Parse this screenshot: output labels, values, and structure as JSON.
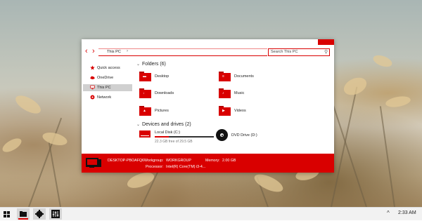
{
  "explorer": {
    "address": "This PC",
    "search_placeholder": "Search This PC",
    "sidebar": [
      {
        "label": "Quick access",
        "icon": "star-icon"
      },
      {
        "label": "OneDrive",
        "icon": "cloud-icon"
      },
      {
        "label": "This PC",
        "icon": "computer-icon",
        "selected": true
      },
      {
        "label": "Network",
        "icon": "network-icon"
      }
    ],
    "folders_heading": "Folders (6)",
    "folders": [
      {
        "label": "Desktop",
        "icon": "desktop-folder-icon"
      },
      {
        "label": "Documents",
        "icon": "documents-folder-icon"
      },
      {
        "label": "Downloads",
        "icon": "downloads-folder-icon"
      },
      {
        "label": "Music",
        "icon": "music-folder-icon"
      },
      {
        "label": "Pictures",
        "icon": "pictures-folder-icon"
      },
      {
        "label": "Videos",
        "icon": "videos-folder-icon"
      }
    ],
    "drives_heading": "Devices and drives (2)",
    "drives": [
      {
        "label": "Local Disk (C:)",
        "free": "22.3 GB free of 29.5 GB",
        "used_fraction": 0.24
      },
      {
        "label": "DVD Drive (D:)"
      }
    ],
    "status": {
      "computer_name": "DESKTOP-PBOAFQ6",
      "workgroup_label": "Workgroup:",
      "workgroup_value": "WORKGROUP",
      "memory_label": "Memory:",
      "memory_value": "2.00 GB",
      "processor_label": "Processor:",
      "processor_value": "Intel(R) Core(TM) i3-4..."
    }
  },
  "taskbar": {
    "clock": "2:33 AM",
    "buttons": [
      "start-button",
      "file-explorer-button",
      "settings-button",
      "control-panel-button"
    ]
  },
  "colors": {
    "accent": "#d90000",
    "taskbar": "#f2f2f2"
  }
}
